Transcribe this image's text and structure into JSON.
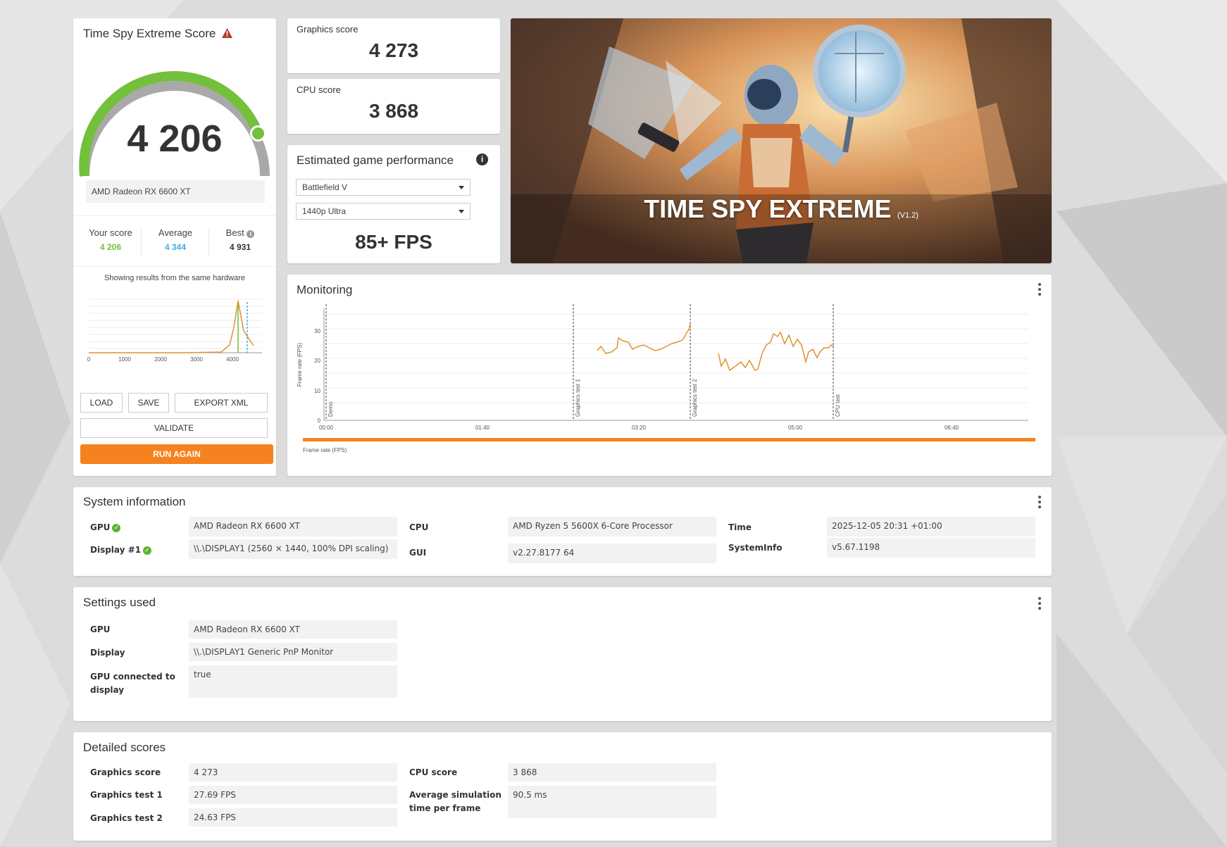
{
  "score_card": {
    "title": "Time Spy Extreme Score",
    "score": "4 206",
    "gpu": "AMD Radeon RX 6600 XT",
    "your_score_label": "Your score",
    "your_score": "4 206",
    "average_label": "Average",
    "average": "4 344",
    "best_label": "Best",
    "best": "4 931",
    "note": "Showing results from the same hardware",
    "hist_ticks": [
      "0",
      "1000",
      "2000",
      "3000",
      "4000"
    ],
    "buttons": {
      "load": "LOAD",
      "save": "SAVE",
      "export": "EXPORT XML",
      "validate": "VALIDATE",
      "run_again": "RUN AGAIN"
    }
  },
  "graphics_score": {
    "label": "Graphics score",
    "value": "4 273"
  },
  "cpu_score": {
    "label": "CPU score",
    "value": "3 868"
  },
  "estimated": {
    "title": "Estimated game performance",
    "game": "Battlefield V",
    "preset": "1440p Ultra",
    "fps": "85+ FPS"
  },
  "banner": {
    "title": "TIME SPY EXTREME",
    "version": "(V1.2)"
  },
  "monitoring": {
    "title": "Monitoring",
    "y_label": "Frame rate (FPS)",
    "y_ticks": [
      "0",
      "10",
      "20",
      "30"
    ],
    "x_ticks": [
      "00:00",
      "01:40",
      "03:20",
      "05:00",
      "06:40"
    ],
    "markers": [
      "Demo",
      "Graphics test 1",
      "Graphics test 2",
      "CPU test"
    ],
    "legend": "Frame rate (FPS)"
  },
  "system_info": {
    "title": "System information",
    "gpu_label": "GPU",
    "gpu": "AMD Radeon RX 6600 XT",
    "display_label": "Display #1",
    "display": "\\\\.\\DISPLAY1 (2560 × 1440, 100% DPI scaling)",
    "cpu_label": "CPU",
    "cpu": "AMD Ryzen 5 5600X 6-Core Processor",
    "gui_label": "GUI",
    "gui": "v2.27.8177 64",
    "time_label": "Time",
    "time": "2025-12-05 20:31 +01:00",
    "sysinfo_label": "SystemInfo",
    "sysinfo": "v5.67.1198"
  },
  "settings": {
    "title": "Settings used",
    "gpu_label": "GPU",
    "gpu": "AMD Radeon RX 6600 XT",
    "display_label": "Display",
    "display": "\\\\.\\DISPLAY1 Generic PnP Monitor",
    "connected_label": "GPU connected to display",
    "connected": "true"
  },
  "detailed": {
    "title": "Detailed scores",
    "gs_label": "Graphics score",
    "gs": "4 273",
    "gt1_label": "Graphics test 1",
    "gt1": "27.69 FPS",
    "gt2_label": "Graphics test 2",
    "gt2": "24.63 FPS",
    "cpu_label": "CPU score",
    "cpu": "3 868",
    "sim_label": "Average simulation time per frame",
    "sim": "90.5 ms"
  },
  "colors": {
    "accent": "#f5821f",
    "green": "#73c03a",
    "blue": "#3ab0e0",
    "line": "#e0922f"
  }
}
